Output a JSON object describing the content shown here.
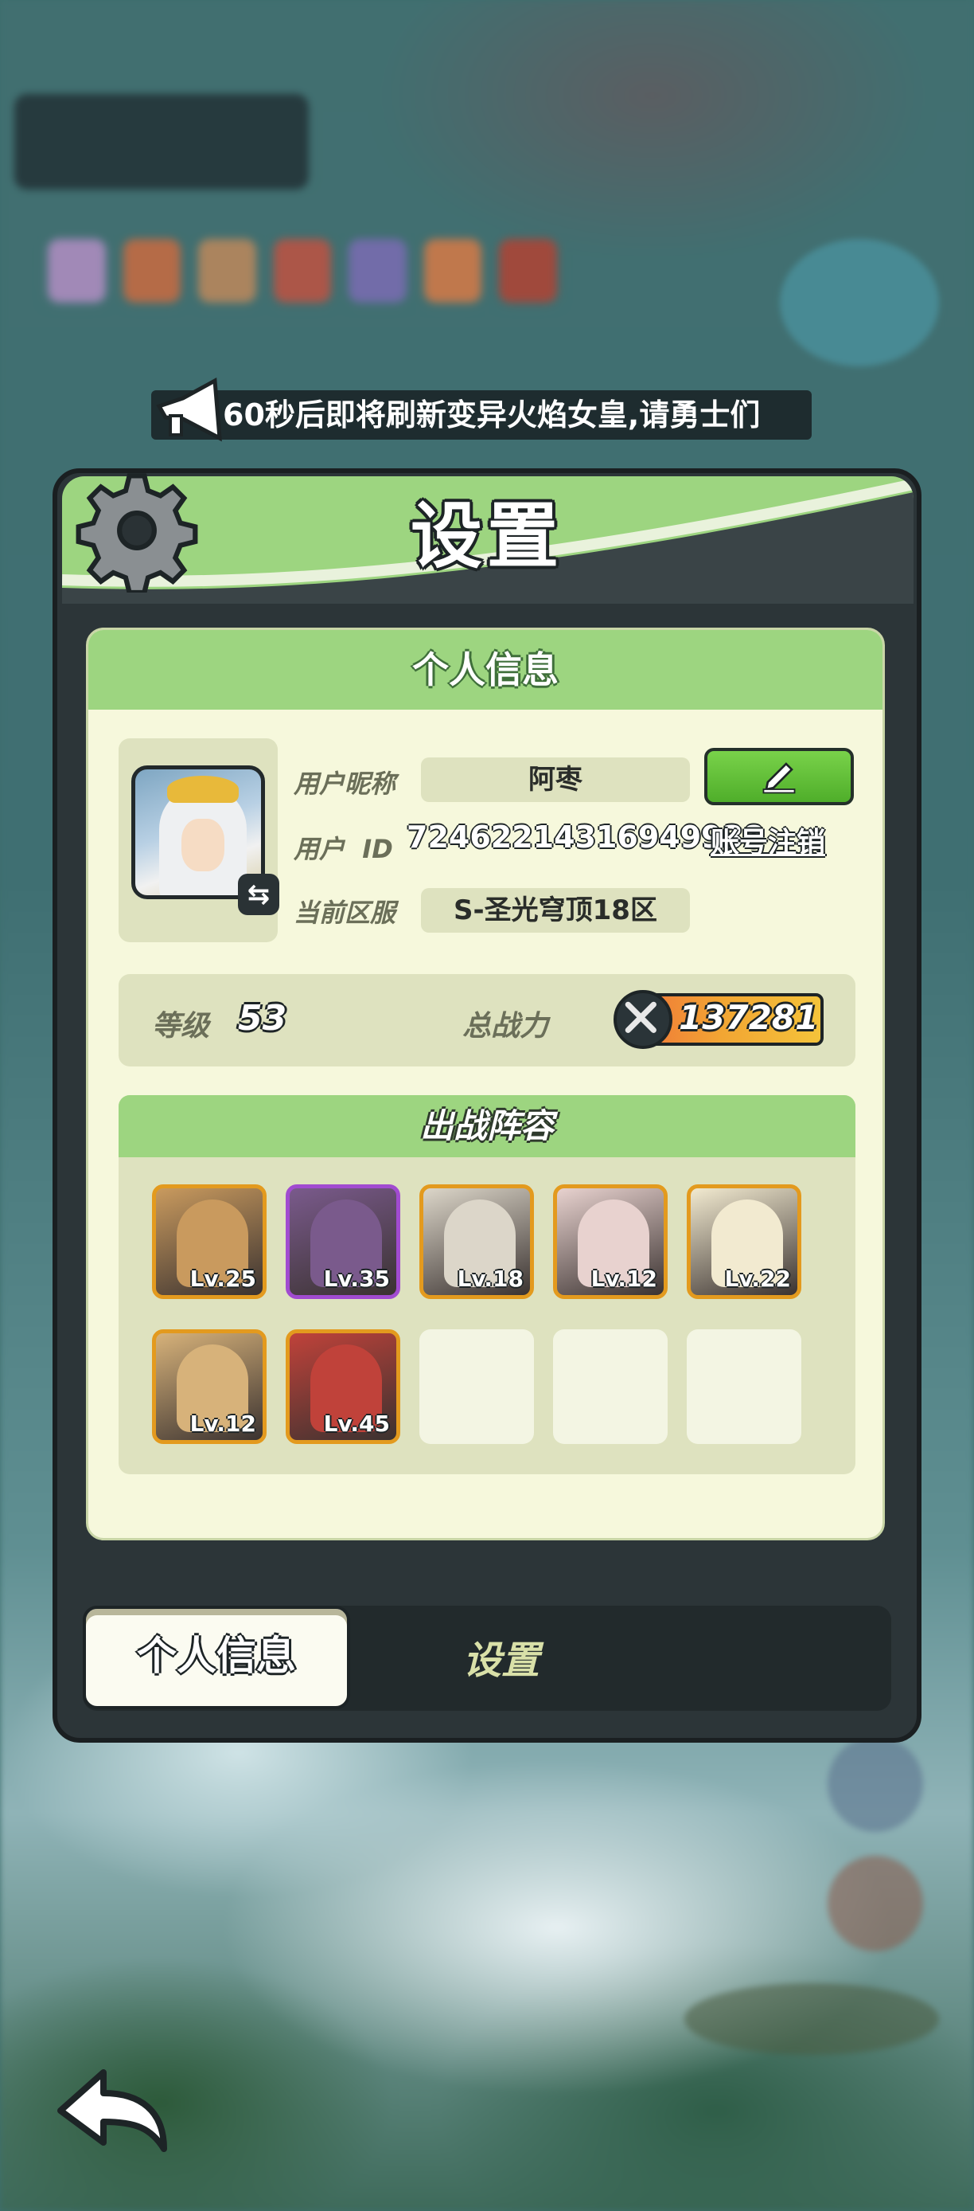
{
  "announcement": {
    "text": "60秒后即将刷新变异火焰女皇,请勇士们"
  },
  "panel": {
    "title": "设置"
  },
  "profile": {
    "section_title": "个人信息",
    "nickname_label": "用户昵称",
    "nickname_value": "阿枣",
    "uid_label": "用户  ID",
    "uid_value": "72462214316949938",
    "cancel_account_label": "账号注销",
    "server_label": "当前区服",
    "server_value": "S-圣光穹顶18区",
    "level_label": "等级",
    "level_value": "53",
    "power_label": "总战力",
    "power_value": "137281"
  },
  "lineup": {
    "title": "出战阵容",
    "heroes": [
      {
        "level": "Lv.25",
        "frame": "orange",
        "color": "#c99a5e"
      },
      {
        "level": "Lv.35",
        "frame": "purple",
        "color": "#7a5a8c"
      },
      {
        "level": "Lv.18",
        "frame": "orange",
        "color": "#dcd6c9"
      },
      {
        "level": "Lv.12",
        "frame": "orange",
        "color": "#e8d2cf"
      },
      {
        "level": "Lv.22",
        "frame": "orange",
        "color": "#f2ead0"
      },
      {
        "level": "Lv.12",
        "frame": "orange",
        "color": "#d7b27a"
      },
      {
        "level": "Lv.45",
        "frame": "orange",
        "color": "#c0423a"
      }
    ],
    "empty_slots": 3
  },
  "tabs": {
    "active": "个人信息",
    "other": "设置"
  },
  "icons": {
    "gear": "gear-icon",
    "megaphone": "megaphone-icon",
    "edit": "pen-icon",
    "swap": "swap-icon",
    "sword": "crossed-swords-icon",
    "back": "back-arrow-icon"
  },
  "colors": {
    "accent_green": "#9dd580",
    "panel_dark": "#2c3538",
    "card_bg": "#f6f8dc",
    "frame_orange": "#e39a1e",
    "frame_purple": "#a14bd0"
  }
}
